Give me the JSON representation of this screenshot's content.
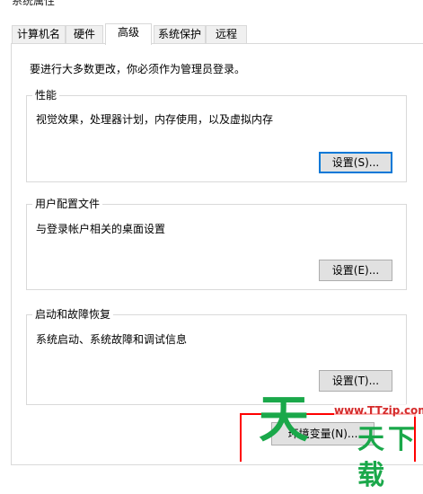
{
  "window": {
    "title": "系统属性"
  },
  "tabs": [
    {
      "label": "计算机名"
    },
    {
      "label": "硬件"
    },
    {
      "label": "高级"
    },
    {
      "label": "系统保护"
    },
    {
      "label": "远程"
    }
  ],
  "active_tab": "高级",
  "notice": "要进行大多数更改，你必须作为管理员登录。",
  "performance": {
    "title": "性能",
    "desc": "视觉效果，处理器计划，内存使用，以及虚拟内存",
    "button": "设置(S)..."
  },
  "user_profiles": {
    "title": "用户配置文件",
    "desc": "与登录帐户相关的桌面设置",
    "button": "设置(E)..."
  },
  "startup_recovery": {
    "title": "启动和故障恢复",
    "desc": "系统启动、系统故障和调试信息",
    "button": "设置(T)..."
  },
  "env_button": "环境变量(N)...",
  "watermark": {
    "logo_char": "天",
    "url": "www.TTzip.com",
    "name": "天下载"
  },
  "colors": {
    "focus_border": "#0078d7",
    "highlight_box": "#ff0000",
    "watermark_green": "#1aa84a",
    "watermark_red": "#d52b2b"
  }
}
